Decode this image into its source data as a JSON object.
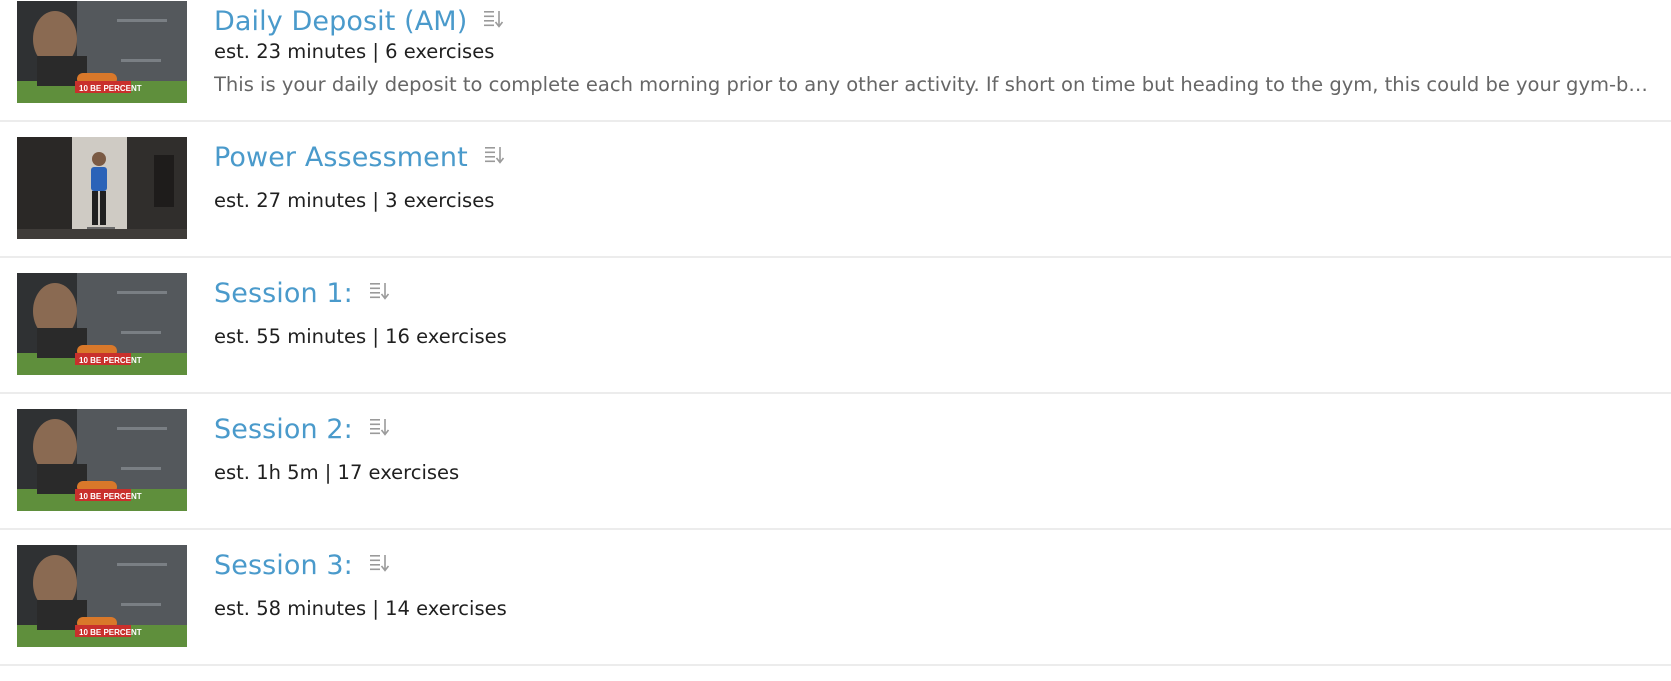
{
  "workouts": [
    {
      "title": "Daily Deposit (AM)",
      "meta": "est. 23 minutes | 6 exercises",
      "description": "This is your daily deposit to complete each morning prior to any other activity. If short on time but heading to the gym, this could be your gym-based wa...",
      "thumbnail_text": [
        "10 BE PERCENT"
      ],
      "icon": "sort-list-icon"
    },
    {
      "title": "Power Assessment",
      "meta": "est. 27 minutes | 3 exercises",
      "description": "",
      "thumbnail_text": [],
      "icon": "sort-list-icon"
    },
    {
      "title": "Session 1:",
      "meta": "est. 55 minutes | 16 exercises",
      "description": "",
      "thumbnail_text": [
        "10 BE PERCENT"
      ],
      "icon": "sort-list-icon"
    },
    {
      "title": "Session 2:",
      "meta": "est. 1h 5m | 17 exercises",
      "description": "",
      "thumbnail_text": [
        "10 BE PERCENT"
      ],
      "icon": "sort-list-icon"
    },
    {
      "title": "Session 3:",
      "meta": "est. 58 minutes | 14 exercises",
      "description": "",
      "thumbnail_text": [
        "10 BE PERCENT"
      ],
      "icon": "sort-list-icon"
    }
  ],
  "colors": {
    "title": "#4a9acb",
    "meta": "#1f1f1f",
    "description": "#666666",
    "divider": "#ececec"
  }
}
